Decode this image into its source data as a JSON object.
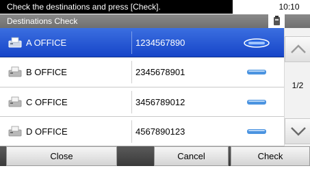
{
  "header": {
    "message": "Check the destinations and press [Check].",
    "time": "10:10",
    "title": "Destinations Check",
    "status_icon": "device-icon"
  },
  "destinations": [
    {
      "name": "A OFFICE",
      "number": "1234567890",
      "selected": true,
      "icon": "fax-machine-icon",
      "badge": "check-badge-icon"
    },
    {
      "name": "B OFFICE",
      "number": "2345678901",
      "selected": false,
      "icon": "fax-machine-icon",
      "badge": "check-badge-icon"
    },
    {
      "name": "C OFFICE",
      "number": "3456789012",
      "selected": false,
      "icon": "fax-machine-icon",
      "badge": "check-badge-icon"
    },
    {
      "name": "D OFFICE",
      "number": "4567890123",
      "selected": false,
      "icon": "fax-machine-icon",
      "badge": "check-badge-icon"
    }
  ],
  "pagination": {
    "indicator": "1/2"
  },
  "buttons": {
    "close": "Close",
    "cancel": "Cancel",
    "check": "Check"
  },
  "colors": {
    "selected_row": "#1f55d6",
    "message_bar": "#000000",
    "title_bar": "#7a7a7a",
    "badge": "#3a8fe0"
  }
}
